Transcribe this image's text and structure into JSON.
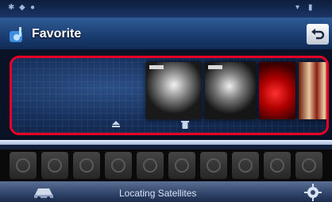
{
  "header": {
    "title": "Favorite"
  },
  "footer": {
    "status_text": "Locating Satellites"
  },
  "favorites": {
    "covers": [
      {
        "name": "album-cover-1"
      },
      {
        "name": "album-cover-2"
      },
      {
        "name": "album-cover-3"
      },
      {
        "name": "album-cover-4"
      }
    ]
  },
  "colors": {
    "highlight_border": "#e60026",
    "title_bar": "#1c3f74",
    "background": "#0a1226"
  },
  "icons": {
    "title": "music-note-icon",
    "back": "back-arrow-icon",
    "eject": "eject-icon",
    "delete": "trash-icon",
    "navigation": "navigation-car-icon",
    "settings": "gear-icon"
  }
}
